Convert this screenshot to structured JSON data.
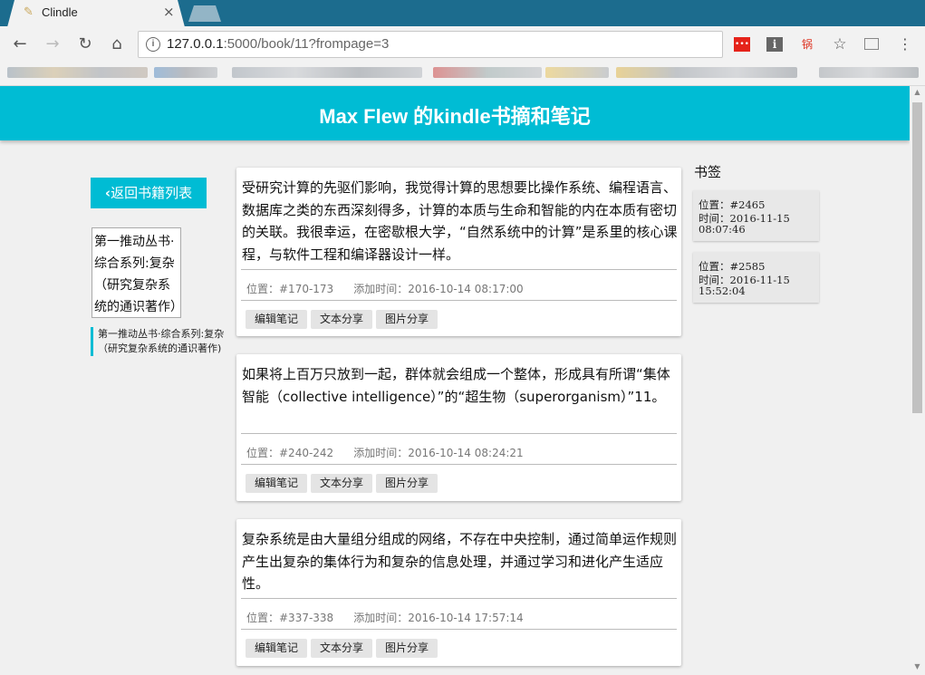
{
  "browser": {
    "tab_title": "Clindle",
    "url_host": "127.0.0.1",
    "url_rest": ":5000/book/11?frompage=3",
    "ext_ext1_label": "•••",
    "ext_ext2_label": "i",
    "ext_ext3_label": "锅"
  },
  "header": {
    "title": "Max Flew 的kindle书摘和笔记"
  },
  "sidebar": {
    "back_label": "返回书籍列表",
    "cover_text": "第一推动丛书·综合系列:复杂（研究复杂系统的通识著作）",
    "book_title": "第一推动丛书·综合系列:复杂（研究复杂系统的通识著作)"
  },
  "notes": [
    {
      "text": "受研究计算的先驱们影响，我觉得计算的思想要比操作系统、编程语言、数据库之类的东西深刻得多，计算的本质与生命和智能的内在本质有密切的关联。我很幸运，在密歇根大学，“自然系统中的计算”是系里的核心课程，与软件工程和编译器设计一样。",
      "position": "位置：#170-173",
      "added": "添加时间：2016-10-14 08:17:00",
      "actions": [
        "编辑笔记",
        "文本分享",
        "图片分享"
      ]
    },
    {
      "text": "如果将上百万只放到一起，群体就会组成一个整体，形成具有所谓“集体智能（collective intelligence）”的“超生物（superorganism）”11。",
      "position": "位置：#240-242",
      "added": "添加时间：2016-10-14 08:24:21",
      "actions": [
        "编辑笔记",
        "文本分享",
        "图片分享"
      ]
    },
    {
      "text": "复杂系统是由大量组分组成的网络，不存在中央控制，通过简单运作规则产生出复杂的集体行为和复杂的信息处理，并通过学习和进化产生适应性。",
      "position": "位置：#337-338",
      "added": "添加时间：2016-10-14 17:57:14",
      "actions": [
        "编辑笔记",
        "文本分享",
        "图片分享"
      ]
    }
  ],
  "bookmarks": {
    "title": "书签",
    "items": [
      {
        "position": "位置：#2465",
        "time_label": "时间：2016-11-15",
        "time_clock": "08:07:46"
      },
      {
        "position": "位置：#2585",
        "time_label": "时间：2016-11-15",
        "time_clock": "15:52:04"
      }
    ]
  },
  "colors": {
    "accent": "#00bcd4",
    "tabstrip": "#1c6c8e"
  }
}
